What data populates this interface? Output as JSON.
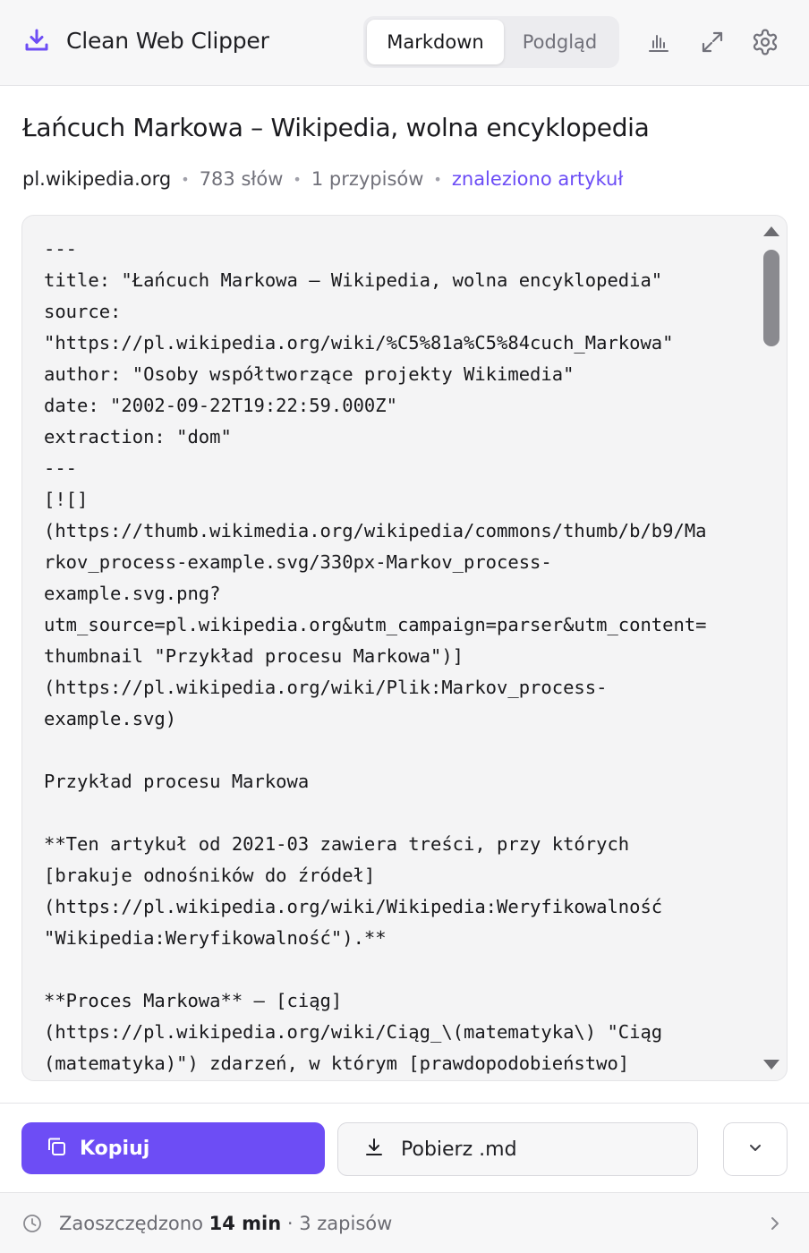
{
  "app": {
    "name": "Clean Web Clipper",
    "brand_color": "#6d4df5"
  },
  "header": {
    "tabs": [
      {
        "label": "Markdown",
        "active": true
      },
      {
        "label": "Podgląd",
        "active": false
      }
    ],
    "icons": [
      "bar-chart-icon",
      "expand-icon",
      "gear-icon"
    ]
  },
  "article": {
    "title": "Łańcuch Markowa – Wikipedia, wolna encyklopedia",
    "domain": "pl.wikipedia.org",
    "word_count": "783 słów",
    "footnotes": "1 przypisów",
    "status": "znaleziono artykuł"
  },
  "markdown": {
    "lines": [
      "---",
      "title: \"Łańcuch Markowa – Wikipedia, wolna encyklopedia\"",
      "source:",
      "\"https://pl.wikipedia.org/wiki/%C5%81a%C5%84cuch_Markowa\"",
      "author: \"Osoby współtworzące projekty Wikimedia\"",
      "date: \"2002-09-22T19:22:59.000Z\"",
      "extraction: \"dom\"",
      "---",
      "[![]",
      "(https://thumb.wikimedia.org/wikipedia/commons/thumb/b/b9/Ma",
      "rkov_process-example.svg/330px-Markov_process-",
      "example.svg.png?",
      "utm_source=pl.wikipedia.org&utm_campaign=parser&utm_content=",
      "thumbnail \"Przykład procesu Markowa\")]",
      "(https://pl.wikipedia.org/wiki/Plik:Markov_process-",
      "example.svg)",
      "",
      "Przykład procesu Markowa",
      "",
      "**Ten artykuł od 2021-03 zawiera treści, przy których",
      "[brakuje odnośników do źródeł]",
      "(https://pl.wikipedia.org/wiki/Wikipedia:Weryfikowalność",
      "\"Wikipedia:Weryfikowalność\").**",
      "",
      "**Proces Markowa** – [ciąg]",
      "(https://pl.wikipedia.org/wiki/Ciąg_\\(matematyka\\) \"Ciąg",
      "(matematyka)\") zdarzeń, w którym [prawdopodobieństwo]"
    ]
  },
  "actions": {
    "copy_label": "Kopiuj",
    "download_label": "Pobierz .md"
  },
  "status": {
    "prefix": "Zaoszczędzono",
    "time_saved": "14 min",
    "separator": "·",
    "saves": "3 zapisów"
  }
}
